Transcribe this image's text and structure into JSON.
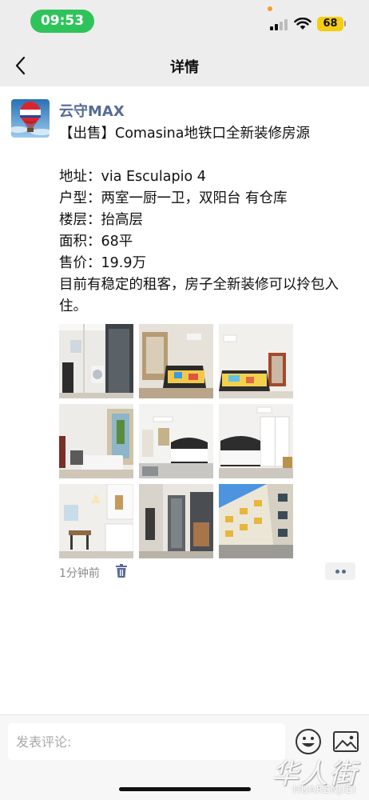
{
  "status_bar": {
    "time": "09:53",
    "battery_level": "68",
    "colors": {
      "time_pill": "#2fc45b",
      "battery": "#f6cd12"
    }
  },
  "nav": {
    "title": "详情",
    "back_icon": "chevron-left-icon"
  },
  "post": {
    "author": "云守MAX",
    "text": "【出售】Comasina地铁口全新装修房源\n\n地址：via Esculapio 4\n户型：两室一厨一卫，双阳台 有仓库\n楼层：抬高层\n面积：68平\n售价：19.9万\n目前有稳定的租客，房子全新装修可以拎包入住。",
    "time": "1分钟前",
    "photo_count": 9,
    "link_color": "#576b95"
  },
  "comment": {
    "placeholder": "发表评论:",
    "icons": [
      "emoji-icon",
      "image-icon"
    ]
  },
  "watermark": {
    "cn": "华人街",
    "en": "HUARENJIEI"
  }
}
